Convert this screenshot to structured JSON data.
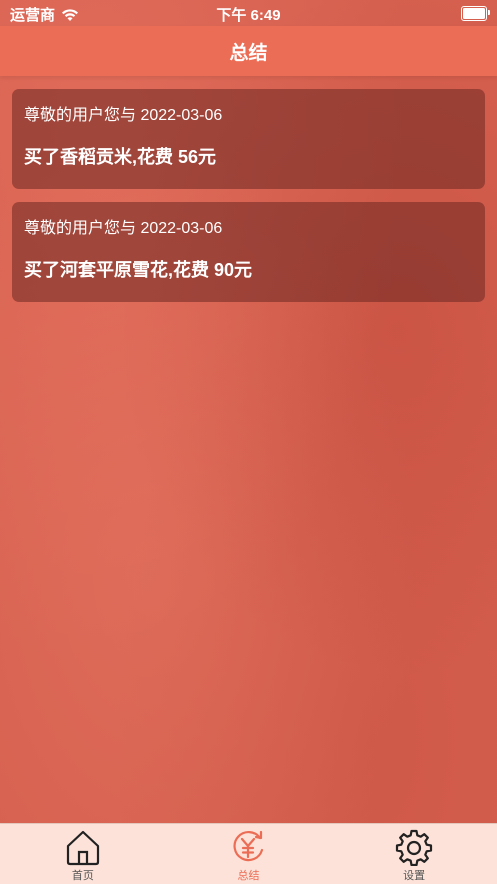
{
  "status_bar": {
    "carrier": "运营商",
    "time": "下午 6:49"
  },
  "nav": {
    "title": "总结"
  },
  "records": [
    {
      "line1": "尊敬的用户您与 2022-03-06",
      "line2": "买了香稻贡米,花费 56元"
    },
    {
      "line1": "尊敬的用户您与 2022-03-06",
      "line2": "买了河套平原雪花,花费 90元"
    }
  ],
  "tabs": [
    {
      "label": "首页",
      "icon": "home-icon",
      "active": false
    },
    {
      "label": "总结",
      "icon": "yuan-refresh-icon",
      "active": true
    },
    {
      "label": "设置",
      "icon": "gear-icon",
      "active": false
    }
  ],
  "colors": {
    "nav": "#ec6d55",
    "background": "#d6604f",
    "tab_bar": "#fce2d8",
    "active_tab": "#ec6d55"
  }
}
